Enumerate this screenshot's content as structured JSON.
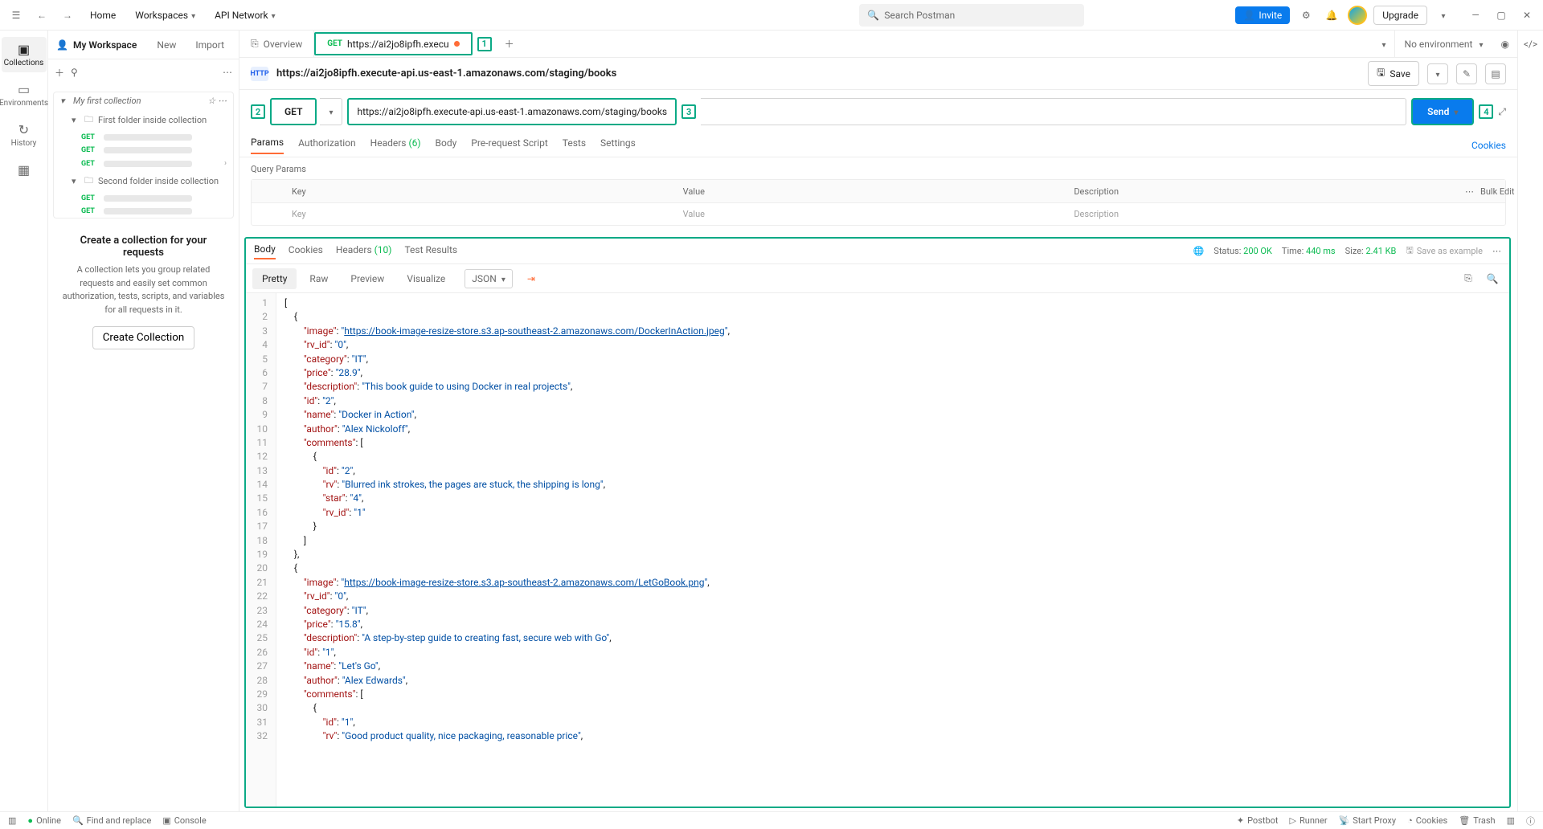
{
  "topbar": {
    "home": "Home",
    "workspaces": "Workspaces",
    "api_network": "API Network",
    "search_placeholder": "Search Postman",
    "invite": "Invite",
    "upgrade": "Upgrade"
  },
  "rail": {
    "collections": "Collections",
    "environments": "Environments",
    "history": "History"
  },
  "sidebar": {
    "workspace": "My Workspace",
    "new": "New",
    "import": "Import",
    "collection_name": "My first collection",
    "folder1": "First folder inside collection",
    "folder2": "Second folder inside collection",
    "cta_title": "Create a collection for your requests",
    "cta_body": "A collection lets you group related requests and easily set common authorization, tests, scripts, and variables for all requests in it.",
    "cta_button": "Create Collection"
  },
  "tabs": {
    "overview": "Overview",
    "req_method": "GET",
    "req_label": "https://ai2jo8ipfh.execu",
    "no_env": "No environment"
  },
  "callouts": {
    "c1": "1",
    "c2": "2",
    "c3": "3",
    "c4": "4"
  },
  "request": {
    "title": "https://ai2jo8ipfh.execute-api.us-east-1.amazonaws.com/staging/books",
    "save": "Save",
    "method": "GET",
    "url": "https://ai2jo8ipfh.execute-api.us-east-1.amazonaws.com/staging/books",
    "send": "Send"
  },
  "req_subtabs": {
    "params": "Params",
    "auth": "Authorization",
    "headers": "Headers",
    "headers_count": "(6)",
    "body": "Body",
    "prereq": "Pre-request Script",
    "tests": "Tests",
    "settings": "Settings",
    "cookies": "Cookies"
  },
  "query_params": {
    "title": "Query Params",
    "key": "Key",
    "value": "Value",
    "desc": "Description",
    "bulk": "Bulk Edit",
    "ph_key": "Key",
    "ph_value": "Value",
    "ph_desc": "Description"
  },
  "response": {
    "tabs": {
      "body": "Body",
      "cookies": "Cookies",
      "headers": "Headers",
      "headers_count": "(10)",
      "tests": "Test Results"
    },
    "status_label": "Status:",
    "status_value": "200 OK",
    "time_label": "Time:",
    "time_value": "440 ms",
    "size_label": "Size:",
    "size_value": "2.41 KB",
    "save_example": "Save as example"
  },
  "body_toolbar": {
    "pretty": "Pretty",
    "raw": "Raw",
    "preview": "Preview",
    "visualize": "Visualize",
    "json": "JSON"
  },
  "response_body": [
    {
      "image": "https://book-image-resize-store.s3.ap-southeast-2.amazonaws.com/DockerInAction.jpeg",
      "rv_id": "0",
      "category": "IT",
      "price": "28.9",
      "description": "This book guide to using Docker in real projects",
      "id": "2",
      "name": "Docker in Action",
      "author": "Alex Nickoloff",
      "comments": [
        {
          "id": "2",
          "rv": "Blurred ink strokes, the pages are stuck, the shipping is long",
          "star": "4",
          "rv_id": "1"
        }
      ]
    },
    {
      "image": "https://book-image-resize-store.s3.ap-southeast-2.amazonaws.com/LetGoBook.png",
      "rv_id": "0",
      "category": "IT",
      "price": "15.8",
      "description": "A step-by-step guide to creating fast, secure web with Go",
      "id": "1",
      "name": "Let's Go",
      "author": "Alex Edwards",
      "comments": [
        {
          "id": "1",
          "rv": "Good product quality, nice packaging, reasonable price"
        }
      ]
    }
  ],
  "footer": {
    "online": "Online",
    "find": "Find and replace",
    "console": "Console",
    "postbot": "Postbot",
    "runner": "Runner",
    "proxy": "Start Proxy",
    "cookies": "Cookies",
    "trash": "Trash"
  }
}
